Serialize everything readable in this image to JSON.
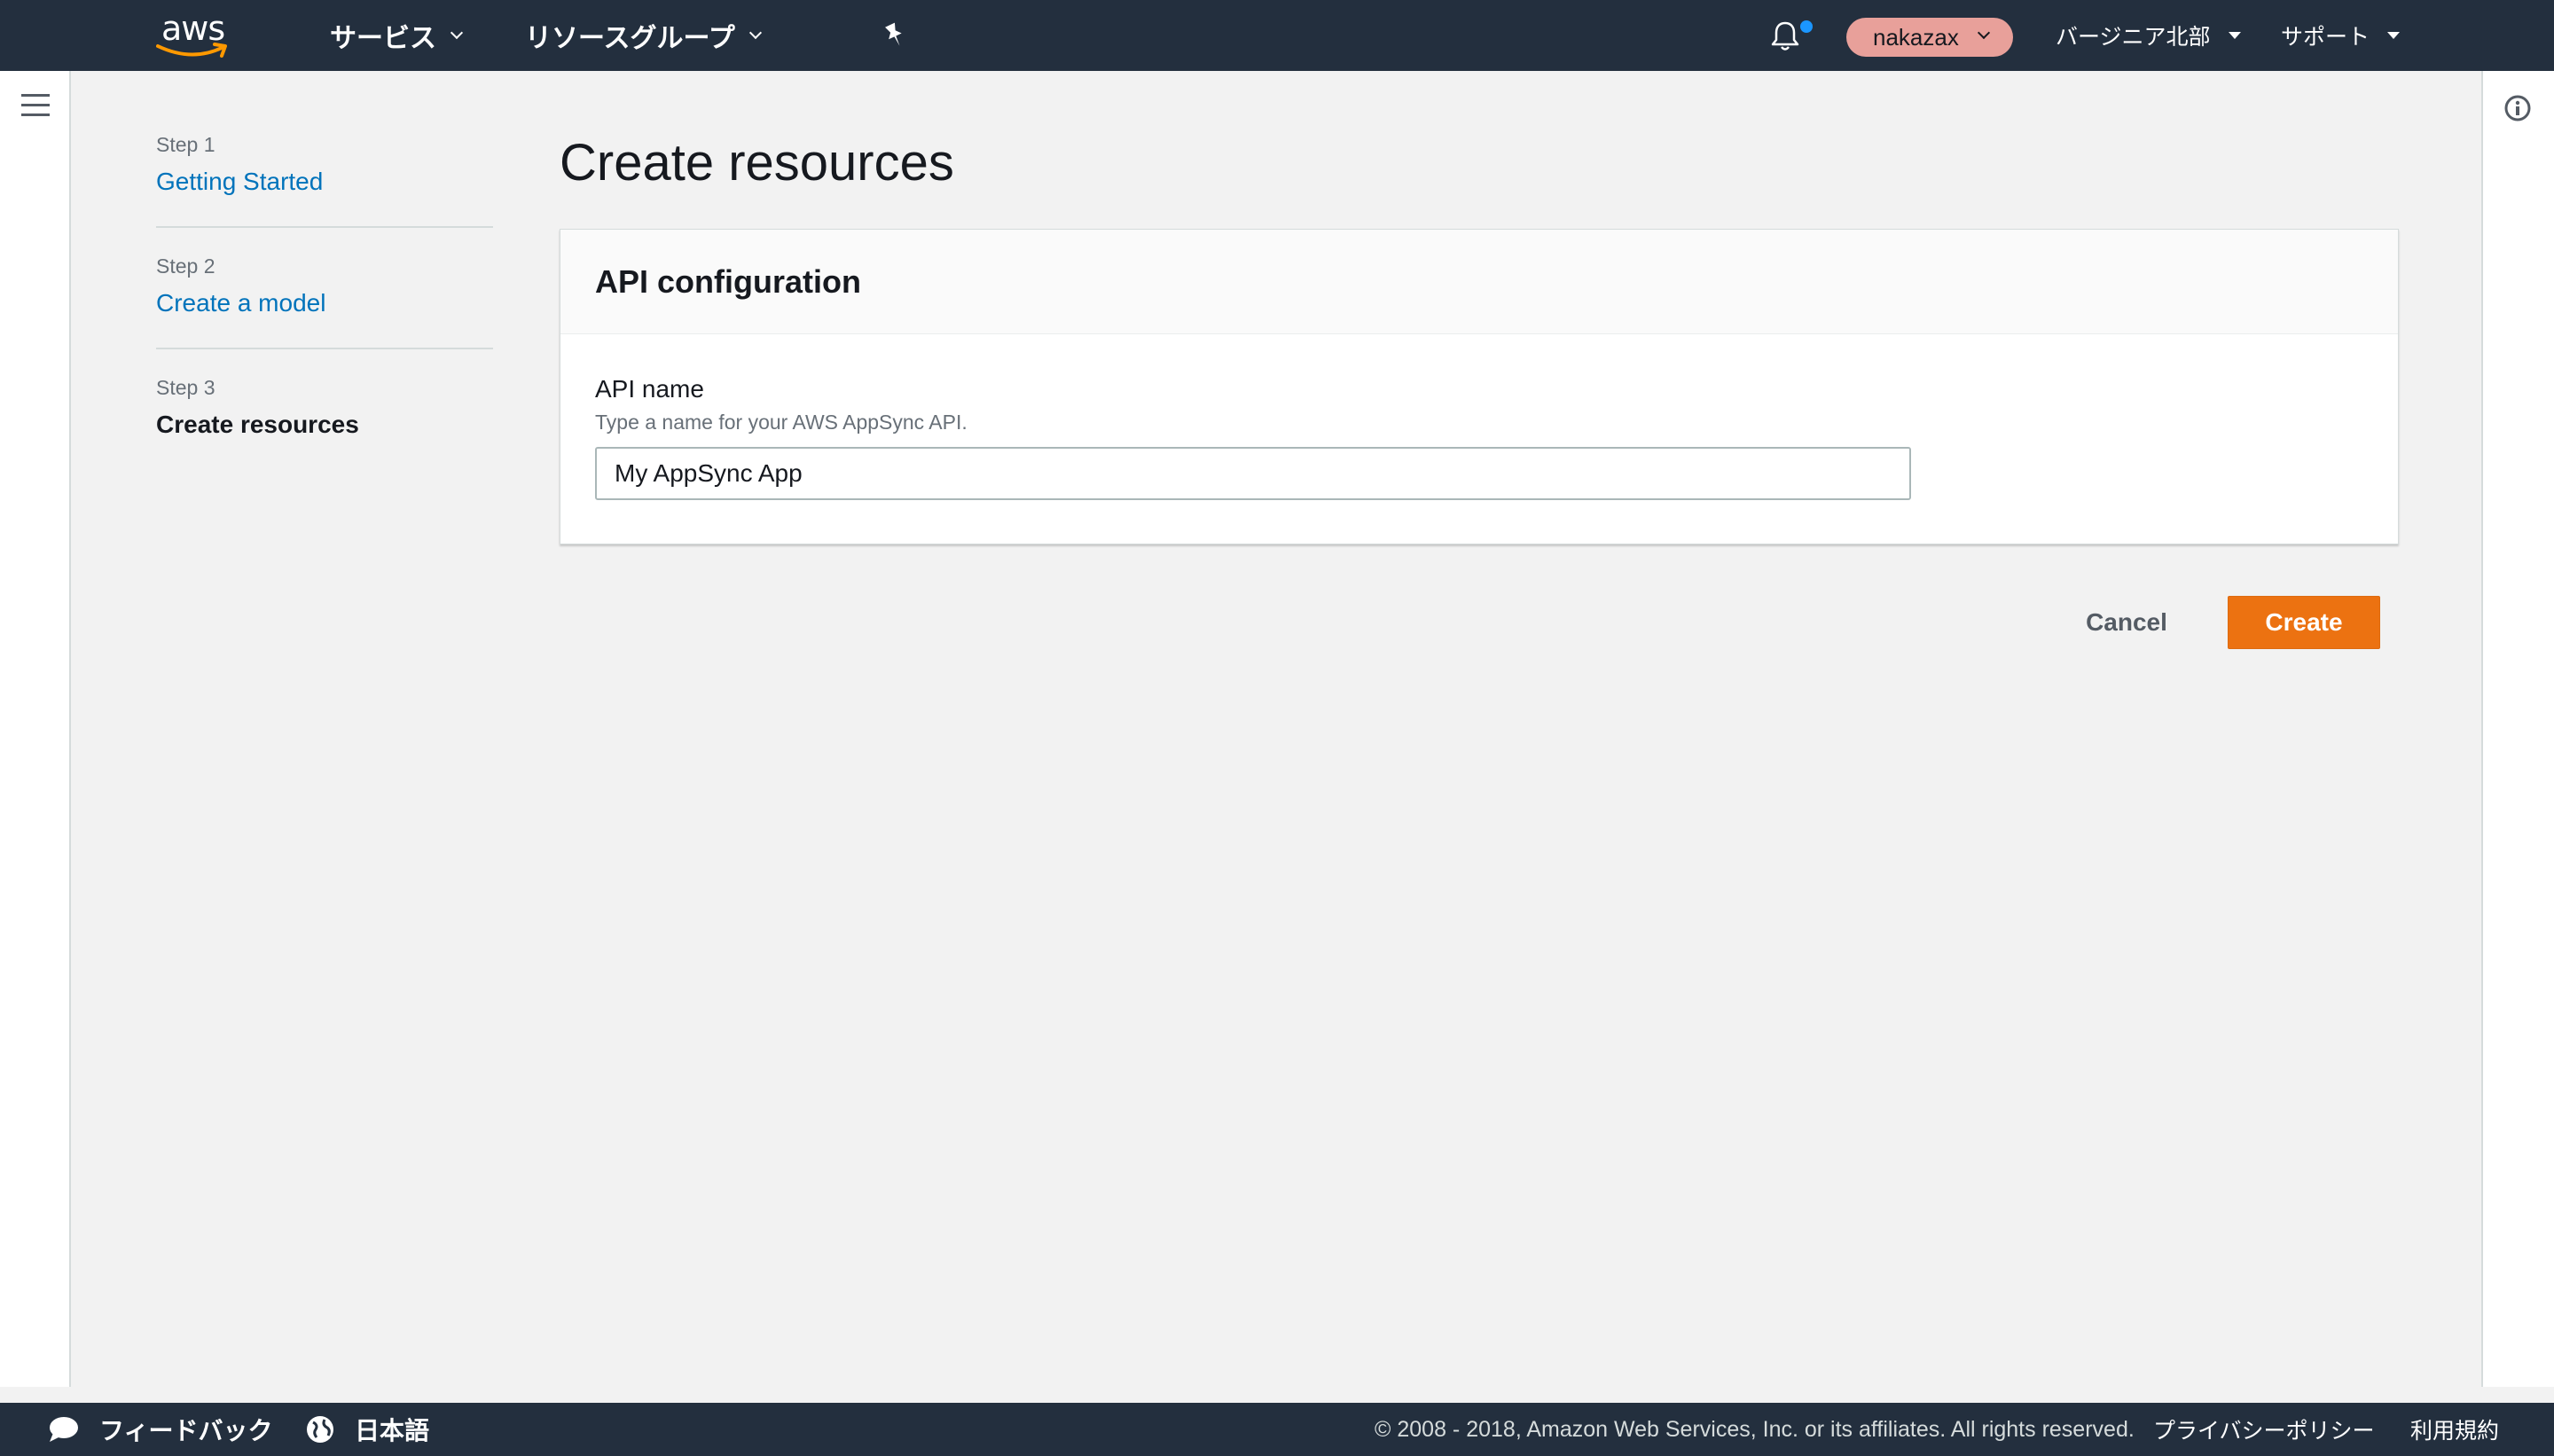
{
  "nav": {
    "logo_text": "aws",
    "services_label": "サービス",
    "resource_groups_label": "リソースグループ",
    "user_label": "nakazax",
    "region_label": "バージニア北部",
    "support_label": "サポート"
  },
  "steps": [
    {
      "number": "Step 1",
      "title": "Getting Started"
    },
    {
      "number": "Step 2",
      "title": "Create a model"
    },
    {
      "number": "Step 3",
      "title": "Create resources"
    }
  ],
  "page": {
    "title": "Create resources"
  },
  "panel": {
    "header": "API configuration",
    "field_label": "API name",
    "field_description": "Type a name for your AWS AppSync API.",
    "field_value": "My AppSync App"
  },
  "actions": {
    "cancel_label": "Cancel",
    "create_label": "Create"
  },
  "footer": {
    "feedback_label": "フィードバック",
    "language_label": "日本語",
    "copyright": "© 2008 - 2018, Amazon Web Services, Inc. or its affiliates. All rights reserved.",
    "privacy_label": "プライバシーポリシー",
    "terms_label": "利用規約"
  },
  "colors": {
    "nav_background": "#232f3e",
    "link": "#0073bb",
    "primary_button": "#ec7211",
    "user_pill": "#e8a09a",
    "notification_dot": "#1b96ff"
  }
}
